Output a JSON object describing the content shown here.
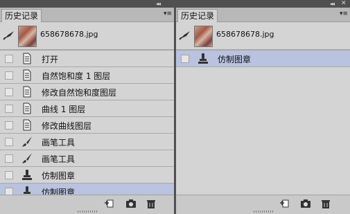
{
  "panels": [
    {
      "tab_label": "历史记录",
      "snapshot": {
        "file_name": "658678678.jpg"
      },
      "history": [
        {
          "label": "打开",
          "icon": "document-icon",
          "selected": false
        },
        {
          "label": "自然饱和度 1 图层",
          "icon": "document-icon",
          "selected": false
        },
        {
          "label": "修改自然饱和度图层",
          "icon": "document-icon",
          "selected": false
        },
        {
          "label": "曲线 1 图层",
          "icon": "document-icon",
          "selected": false
        },
        {
          "label": "修改曲线图层",
          "icon": "document-icon",
          "selected": false
        },
        {
          "label": "画笔工具",
          "icon": "brush-icon",
          "selected": false
        },
        {
          "label": "画笔工具",
          "icon": "brush-icon",
          "selected": false
        },
        {
          "label": "仿制图章",
          "icon": "stamp-icon",
          "selected": false
        },
        {
          "label": "仿制图章",
          "icon": "stamp-icon",
          "selected": true
        }
      ]
    },
    {
      "tab_label": "历史记录",
      "snapshot": {
        "file_name": "658678678.jpg"
      },
      "history": [
        {
          "label": "仿制图章",
          "icon": "stamp-icon",
          "selected": true
        }
      ]
    }
  ],
  "topbar": {
    "collapse_glyph": "◂◂",
    "close_glyph": "✕"
  },
  "menu_glyph": "▾≡",
  "footer_buttons": [
    "new-document-from-state-icon",
    "camera-icon",
    "trash-icon"
  ],
  "colors": {
    "panel_bg": "#d4d4d4",
    "selected_row": "#b9c3df",
    "chrome_dark": "#505050"
  }
}
